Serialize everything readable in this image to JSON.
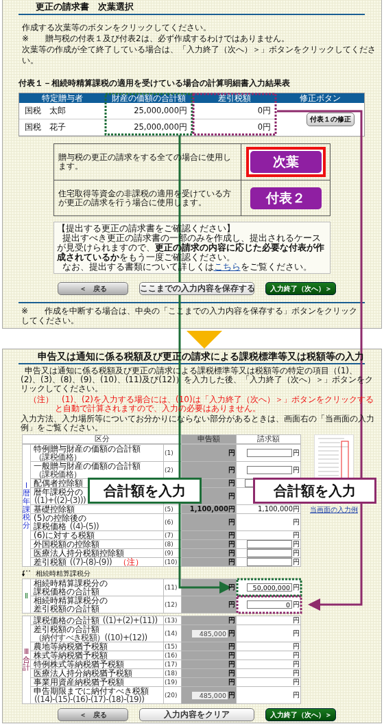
{
  "top_screen": {
    "title": "更正の請求書　次葉選択",
    "instructions": [
      "作成する次葉等のボタンをクリックしてください。",
      "※　　贈与税の付表１及び付表2は、必ず作成するわけではありません。",
      "次葉等の作成が全て終了している場合は、「入力終了（次へ）＞」ボタンをクリックしてください。"
    ],
    "results_table": {
      "title": "付表１－相続時精算課税の適用を受けている場合の計算明細書入力結果表",
      "columns": [
        "特定贈与者",
        "財産の価額の合計額",
        "差引税額",
        "修正ボタン"
      ],
      "rows": [
        {
          "donor": "国税　太郎",
          "property_total": "25,000,000円",
          "tax": "0円"
        },
        {
          "donor": "国税　花子",
          "property_total": "25,000,000円",
          "tax": "0円"
        }
      ],
      "edit_button": "付表１の修正"
    },
    "choices": [
      {
        "description": "贈与税の更正の請求をする全ての場合に使用します。",
        "button": "次葉",
        "highlighted": true
      },
      {
        "description": "住宅取得等資金の非課税の適用を受けている方が更正の請求を行う場合に使用します。",
        "button": "付表２",
        "highlighted": false
      }
    ],
    "notice": {
      "heading": "【提出する更正の請求書をご確認ください】",
      "body": "提出すべき更正の請求書の一部のみを作成し、提出されるケースが見受けられますので、**更正の請求の内容に応じた必要な付表が作成されているか**をもう一度ご確認ください。",
      "link_before": "なお、提出する書類について詳しくは",
      "link": "こちら",
      "link_after": "をご覧ください。"
    },
    "buttons": [
      {
        "label": "＜　戻る",
        "kind": "back"
      },
      {
        "label": "ここまでの入力内容を保存する",
        "kind": "save"
      },
      {
        "label": "入力終了（次へ）＞",
        "kind": "next"
      }
    ],
    "footer": "※　　作成を中断する場合は、中央の「ここまでの入力内容を保存する」ボタンをクリックしてください。"
  },
  "bottom_screen": {
    "title": "申告又は通知に係る税額及び更正の請求による課税標準等又は税額等の入力",
    "intro": "申告又は通知に係る税額及び更正の請求による課税標準等又は税額等の特定の項目（(1)、(2)、(3)、(8)、(9)、(10)、(11)及び(12)）を入力した後、「入力終了（次へ）＞」ボタンをクリックしてください。",
    "note": "（注）　(1)、(2)を入力する場合には、(10)は「入力終了（次へ）＞」ボタンをクリックすると自動で計算されますので、入力の必要はありません。",
    "help": "入力方法、入力場所等についてお分かりにならない部分があるときは、画面右の「当画面の入力例」をご覧ください。",
    "columns": [
      "区分",
      "申告額",
      "請求額"
    ],
    "sections": [
      {
        "marker": "Ⅰ暦年課税分",
        "color": "#1f2fd0",
        "rows": [
          {
            "lines": [
              {
                "text": "特例贈与財産の価額の合計額"
              },
              {
                "formula": "（課税価格）"
              }
            ],
            "no": "(1)",
            "declared": {
              "kind": "text",
              "unit": "円"
            },
            "claim": {
              "kind": "input",
              "unit": "円"
            }
          },
          {
            "lines": [
              {
                "text": "一般贈与財産の価額の合計額"
              },
              {
                "formula": "（課税価格）"
              }
            ],
            "no": "(2)",
            "declared": {
              "kind": "text",
              "unit": "円"
            },
            "claim": {
              "kind": "input",
              "unit": "円"
            }
          },
          {
            "lines": [
              {
                "text": "配偶者控除額"
              }
            ],
            "declared": {
              "kind": "text",
              "unit": "円"
            },
            "claim": {
              "kind": "input"
            }
          },
          {
            "lines": [
              {
                "text": "暦年課税分の"
              },
              {
                "formula": "((1)+((2)-(3)))"
              }
            ],
            "declared": {
              "kind": "text",
              "unit": "円"
            },
            "claim": {
              "kind": "empty"
            }
          },
          {
            "lines": [
              {
                "text": "基礎控除額"
              }
            ],
            "no": "(5)",
            "declared": {
              "kind": "text",
              "value": "1,100,000",
              "unit": "円"
            },
            "claim": {
              "kind": "text",
              "value": "1,100,000",
              "unit": "円"
            }
          },
          {
            "lines": [
              {
                "text": "(5)の控除後の"
              },
              {
                "text": "課税価格",
                "formula": "((4)-(5))"
              }
            ],
            "no": "(6)",
            "declared": {
              "kind": "text",
              "unit": "円"
            },
            "claim": {
              "kind": "text",
              "unit": "円"
            }
          },
          {
            "lines": [
              {
                "text": "(6)に対する税額"
              }
            ],
            "no": "(7)",
            "declared": {
              "kind": "text",
              "unit": "円"
            },
            "claim": {
              "kind": "text",
              "unit": "円"
            }
          },
          {
            "lines": [
              {
                "text": "外国税額の控除額"
              }
            ],
            "no": "(8)",
            "declared": {
              "kind": "text",
              "unit": "円"
            },
            "claim": {
              "kind": "input",
              "unit": "円"
            }
          },
          {
            "lines": [
              {
                "text": "医療法人持分税額控除額"
              }
            ],
            "no": "(9)",
            "declared": {
              "kind": "text",
              "unit": "円"
            },
            "claim": {
              "kind": "input",
              "unit": "円"
            }
          },
          {
            "lines": [
              {
                "text": "差引税額",
                "formula": "((7)-(8)-(9))",
                "note": "（注）"
              }
            ],
            "no": "(10)",
            "declared": {
              "kind": "text",
              "unit": "円"
            },
            "claim": {
              "kind": "input",
              "unit": "円"
            }
          }
        ]
      },
      {
        "heading": "相続時精算課税分",
        "marker": "Ⅱ",
        "color": "#1d7a2a",
        "rows": [
          {
            "lines": [
              {
                "text": "相続時精算課税分の"
              },
              {
                "text": "課税価格の合計額"
              }
            ],
            "no": "(11)",
            "declared": {
              "kind": "text",
              "unit": "円"
            },
            "claim": {
              "kind": "input",
              "value": "50,000,000",
              "unit": "円"
            }
          },
          {
            "lines": [
              {
                "text": "相続時精算課税分の"
              },
              {
                "text": "差引税額の合計額"
              }
            ],
            "no": "(12)",
            "declared": {
              "kind": "text",
              "unit": "円"
            },
            "claim": {
              "kind": "input",
              "value": "0",
              "unit": "円"
            }
          }
        ]
      },
      {
        "marker": "Ⅲ合計",
        "color": "#8a1c4c",
        "rows": [
          {
            "lines": [
              {
                "text": "課税価格の合計額",
                "formula": "((1)+(2)+(11))"
              }
            ],
            "no": "(13)",
            "declared": {
              "kind": "text",
              "unit": "円"
            },
            "claim": {
              "kind": "text",
              "unit": "円"
            }
          },
          {
            "lines": [
              {
                "text": "差引税額の合計額"
              },
              {
                "formula": "（納付すべき税額）((10)+(12))"
              }
            ],
            "no": "(14)",
            "declared": {
              "kind": "readonly",
              "value": "485,000",
              "unit": "円"
            },
            "claim": {
              "kind": "text",
              "unit": "円"
            }
          },
          {
            "lines": [
              {
                "text": "農地等納税猶予税額"
              }
            ],
            "no": "(15)",
            "declared": {
              "kind": "text",
              "unit": "円"
            },
            "claim": {
              "kind": "text",
              "unit": "円"
            }
          },
          {
            "lines": [
              {
                "text": "株式等納税猶予税額"
              }
            ],
            "no": "(16)",
            "declared": {
              "kind": "text",
              "unit": "円"
            },
            "claim": {
              "kind": "text",
              "unit": "円"
            }
          },
          {
            "lines": [
              {
                "text": "特例株式等納税猶予税額"
              }
            ],
            "no": "(17)",
            "declared": {
              "kind": "text",
              "unit": "円"
            },
            "claim": {
              "kind": "text",
              "unit": "円"
            }
          },
          {
            "lines": [
              {
                "text": "医療法人持分納税猶予税額"
              }
            ],
            "no": "(18)",
            "declared": {
              "kind": "text",
              "unit": "円"
            },
            "claim": {
              "kind": "text",
              "unit": "円"
            }
          },
          {
            "lines": [
              {
                "text": "事業用資産納税猶予税額"
              }
            ],
            "no": "(19)",
            "declared": {
              "kind": "text",
              "unit": "円"
            },
            "claim": {
              "kind": "text",
              "unit": "円"
            }
          },
          {
            "lines": [
              {
                "text": "申告期限までに納付すべき税額"
              },
              {
                "formula": "((14)-(15)-(16)-(17)-(18)-(19))"
              }
            ],
            "no": "(20)",
            "declared": {
              "kind": "readonly",
              "value": "485,000",
              "unit": "円"
            },
            "claim": {
              "kind": "text",
              "unit": "円"
            }
          }
        ]
      }
    ],
    "example_link": "当画面の入力例",
    "buttons": [
      {
        "label": "＜　戻る",
        "kind": "back"
      },
      {
        "label": "入力内容をクリア",
        "kind": "save"
      },
      {
        "label": "入力終了（次へ）＞",
        "kind": "next"
      }
    ]
  },
  "annotations": [
    {
      "text": "合計額を入力",
      "color": "#1d6e38"
    },
    {
      "text": "合計額を入力",
      "color": "#8e2b6c"
    }
  ]
}
